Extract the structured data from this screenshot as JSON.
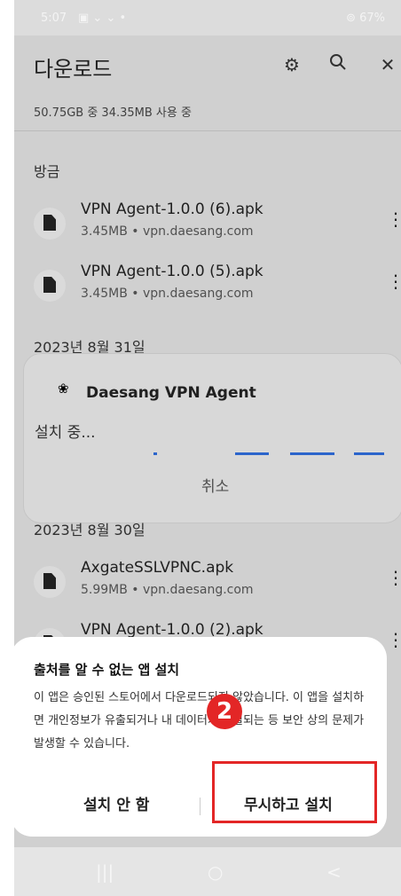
{
  "status_bar": {
    "time": "5:07",
    "left_icons": "▣ ⌄ ⌄ •",
    "right": "⊚ 67%"
  },
  "app_bar": {
    "title": "다운로드",
    "settings_icon": "gear-icon",
    "search_icon": "search-icon",
    "close_icon": "close-icon"
  },
  "storage": "50.75GB 중 34.35MB 사용 중",
  "sections": {
    "recent": "방금",
    "aug31": "2023년 8월 31일",
    "aug30": "2023년 8월 30일"
  },
  "files": [
    {
      "name": "VPN Agent-1.0.0 (6).apk",
      "meta": "3.45MB • vpn.daesang.com"
    },
    {
      "name": "VPN Agent-1.0.0 (5).apk",
      "meta": "3.45MB • vpn.daesang.com"
    },
    {
      "name": "AxgateSSLVPNC.apk",
      "meta": "5.99MB • vpn.daesang.com"
    },
    {
      "name": "VPN Agent-1.0.0 (2).apk",
      "meta": ""
    }
  ],
  "install_card": {
    "app_name": "Daesang VPN Agent",
    "status": "설치 중...",
    "cancel": "취소"
  },
  "dialog": {
    "title": "출처를 알 수 없는 앱 설치",
    "body": "이 앱은 승인된 스토어에서 다운로드되지 않았습니다. 이 앱을 설치하면 개인정보가 유출되거나 내 데이터가 손실되는 등 보안 상의 문제가 발생할 수 있습니다.",
    "cancel_button": "설치 안 함",
    "confirm_button": "무시하고 설치"
  },
  "annotation": {
    "step": "2"
  },
  "nav_bar": {
    "recents": "|||",
    "home": "○",
    "back": "<"
  },
  "colors": {
    "accent": "#2f6bd6",
    "annotation": "#e32626"
  }
}
